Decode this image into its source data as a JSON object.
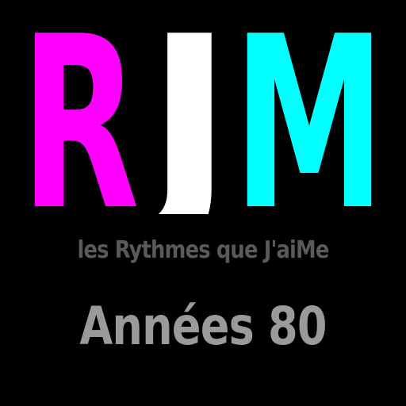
{
  "logo": {
    "letters": [
      {
        "char": "R",
        "color": "#ff00ff"
      },
      {
        "char": "J",
        "color": "#ffffff"
      },
      {
        "char": "M",
        "color": "#00ffff"
      }
    ],
    "tagline": "les Rythmes que J'aiMe",
    "era": "Années 80",
    "background_color": "#000000",
    "tagline_color": "#5a5a5a",
    "era_color": "#9a9a9a"
  }
}
